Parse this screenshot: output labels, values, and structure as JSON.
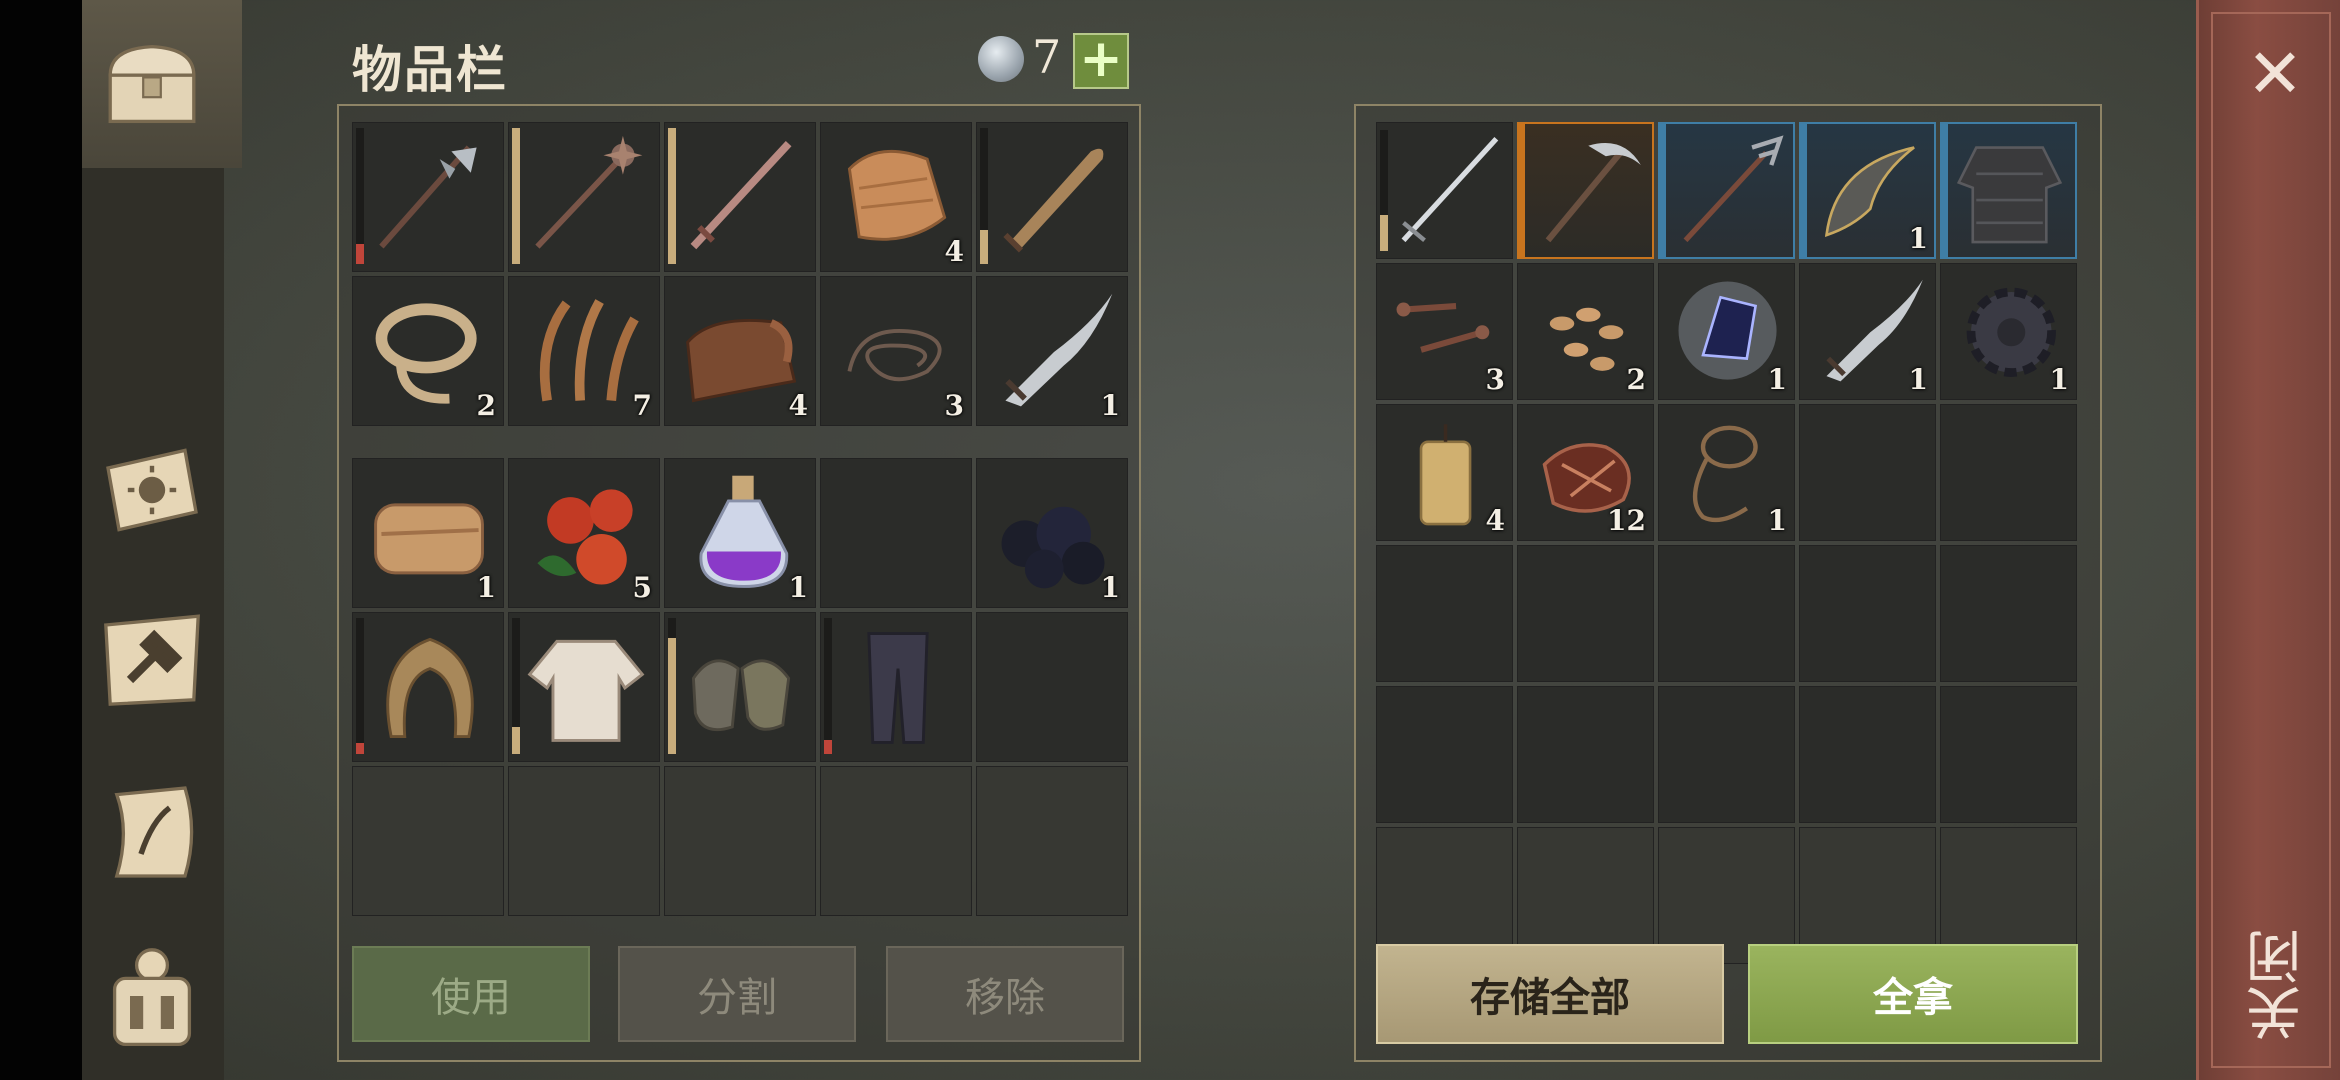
{
  "title": "物品栏",
  "currency": {
    "icon": "silver-coin-icon",
    "amount": "7",
    "add_label": "+"
  },
  "close": {
    "icon": "close-icon",
    "glyph": "✕",
    "label": "关闭"
  },
  "sidebar": {
    "items": [
      {
        "icon": "chest-icon",
        "active": true
      },
      {
        "icon": "sun-book-icon",
        "active": false
      },
      {
        "icon": "crafting-hammer-icon",
        "active": false
      },
      {
        "icon": "quest-scroll-icon",
        "active": false
      },
      {
        "icon": "backpack-icon",
        "active": false
      }
    ]
  },
  "inventory": {
    "section1": [
      {
        "icon": "halberd-icon",
        "count": "",
        "durability": 0.15,
        "durability_color": "#c0453a"
      },
      {
        "icon": "spiked-mace-icon",
        "count": "",
        "durability": 1.0,
        "durability_color": "#c8ad7c"
      },
      {
        "icon": "sword-icon",
        "count": "",
        "durability": 1.0,
        "durability_color": "#c8ad7c"
      },
      {
        "icon": "cloth-icon",
        "count": "4"
      },
      {
        "icon": "bronze-blade-icon",
        "count": "",
        "durability": 0.25,
        "durability_color": "#c8ad7c"
      },
      {
        "icon": "rope-icon",
        "count": "2"
      },
      {
        "icon": "plant-fiber-icon",
        "count": "7"
      },
      {
        "icon": "leather-icon",
        "count": "4"
      },
      {
        "icon": "wire-icon",
        "count": "3"
      },
      {
        "icon": "hook-blade-icon",
        "count": "1"
      }
    ],
    "section2": [
      {
        "icon": "folded-cloth-icon",
        "count": "1"
      },
      {
        "icon": "berries-icon",
        "count": "5"
      },
      {
        "icon": "purple-potion-icon",
        "count": "1"
      },
      {
        "icon": "",
        "count": ""
      },
      {
        "icon": "coal-icon",
        "count": "1"
      },
      {
        "icon": "hood-icon",
        "count": "",
        "durability": 0.08,
        "durability_color": "#c0453a"
      },
      {
        "icon": "shirt-icon",
        "count": "",
        "durability": 0.2,
        "durability_color": "#c8ad7c"
      },
      {
        "icon": "gloves-icon",
        "count": "",
        "durability": 0.85,
        "durability_color": "#c8ad7c"
      },
      {
        "icon": "trousers-icon",
        "count": "",
        "durability": 0.1,
        "durability_color": "#c0453a"
      },
      {
        "icon": "",
        "count": ""
      },
      {
        "icon": "",
        "count": ""
      },
      {
        "icon": "",
        "count": ""
      },
      {
        "icon": "",
        "count": ""
      },
      {
        "icon": "",
        "count": ""
      },
      {
        "icon": "",
        "count": ""
      }
    ],
    "buttons": {
      "use": "使用",
      "split": "分割",
      "remove": "移除"
    }
  },
  "storage": {
    "slots": [
      {
        "icon": "longsword-icon",
        "count": "",
        "durability": 0.3,
        "durability_color": "#c8ad7c"
      },
      {
        "icon": "pickaxe-icon",
        "count": "",
        "rarity": "orange"
      },
      {
        "icon": "trident-icon",
        "count": "",
        "rarity": "blue"
      },
      {
        "icon": "ornate-bow-icon",
        "count": "1",
        "rarity": "blue"
      },
      {
        "icon": "chainmail-icon",
        "count": "",
        "rarity": "blue"
      },
      {
        "icon": "nails-icon",
        "count": "3"
      },
      {
        "icon": "seeds-icon",
        "count": "2"
      },
      {
        "icon": "dark-crystal-icon",
        "count": "1"
      },
      {
        "icon": "hook-blade-icon",
        "count": "1"
      },
      {
        "icon": "gear-icon",
        "count": "1"
      },
      {
        "icon": "candle-icon",
        "count": "4"
      },
      {
        "icon": "scrap-leather-icon",
        "count": "12"
      },
      {
        "icon": "lasso-icon",
        "count": "1"
      },
      {
        "icon": "",
        "count": ""
      },
      {
        "icon": "",
        "count": ""
      },
      {
        "icon": "",
        "count": ""
      },
      {
        "icon": "",
        "count": ""
      },
      {
        "icon": "",
        "count": ""
      },
      {
        "icon": "",
        "count": ""
      },
      {
        "icon": "",
        "count": ""
      },
      {
        "icon": "",
        "count": ""
      },
      {
        "icon": "",
        "count": ""
      },
      {
        "icon": "",
        "count": ""
      },
      {
        "icon": "",
        "count": ""
      },
      {
        "icon": "",
        "count": ""
      },
      {
        "icon": "",
        "count": ""
      },
      {
        "icon": "",
        "count": ""
      },
      {
        "icon": "",
        "count": ""
      },
      {
        "icon": "",
        "count": ""
      },
      {
        "icon": "",
        "count": ""
      }
    ],
    "buttons": {
      "store_all": "存储全部",
      "take_all": "全拿"
    }
  },
  "colors": {
    "rarity_orange": "#c8741e",
    "rarity_blue": "#3f7ea6"
  }
}
